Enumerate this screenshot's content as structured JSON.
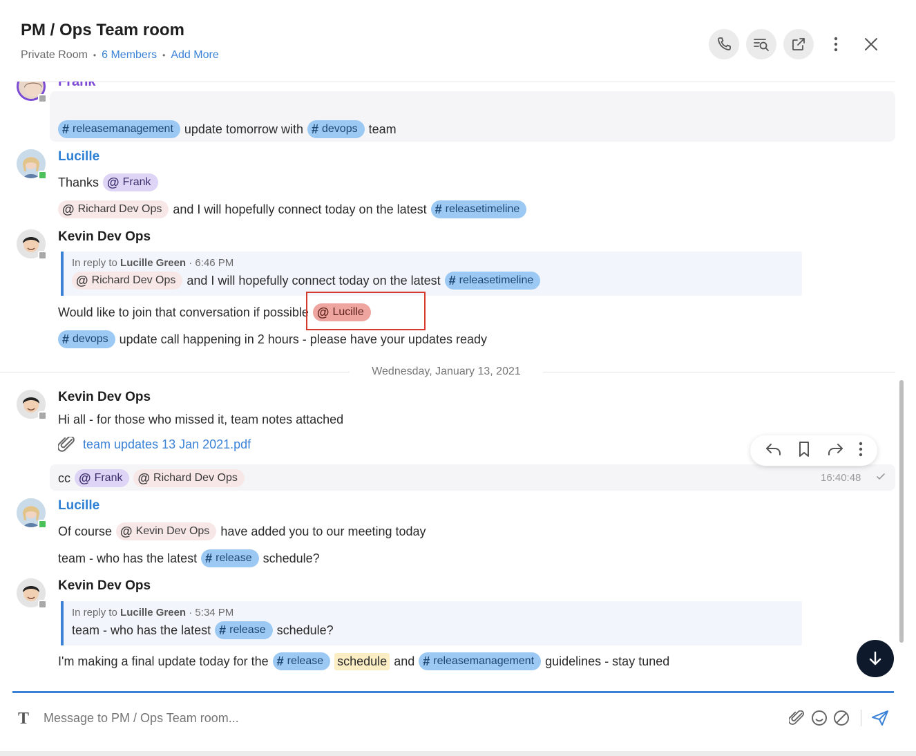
{
  "header": {
    "title": "PM / Ops Team room",
    "room_type": "Private Room",
    "members_link": "6 Members",
    "add_more_link": "Add More",
    "icons": [
      "phone-icon",
      "search-thread-icon",
      "external-link-icon",
      "more-vertical-icon",
      "close-icon"
    ]
  },
  "messages": {
    "m0": {
      "author": "Frank",
      "l1": {
        "tag1": "releasemanagement",
        "t1": "update tomorrow with",
        "tag2": "devops",
        "t2": "team"
      }
    },
    "m1": {
      "author": "Lucille",
      "l1": {
        "t1": "Thanks",
        "mention": "Frank"
      },
      "l2": {
        "mention": "Richard Dev Ops",
        "t1": "and I will hopefully connect today on the latest",
        "tag": "releasetimeline"
      }
    },
    "m2": {
      "author": "Kevin Dev Ops",
      "reply": {
        "prefix": "In reply to",
        "name": "Lucille Green",
        "time": "· 6:46 PM",
        "mention": "Richard Dev Ops",
        "t1": "and I will hopefully connect today on the latest",
        "tag": "releasetimeline"
      },
      "l1": {
        "t1": "Would like to join that conversation if possible",
        "mention": "Lucille"
      },
      "l2": {
        "tag": "devops",
        "t1": "update call happening in 2 hours - please have your updates ready"
      }
    },
    "date_separator": "Wednesday, January 13, 2021",
    "m3": {
      "author": "Kevin Dev Ops",
      "l1": "Hi all - for those who missed it, team notes attached",
      "file": "team updates 13 Jan 2021.pdf",
      "cc": {
        "prefix": "cc",
        "mention1": "Frank",
        "mention2": "Richard Dev Ops"
      },
      "timestamp": "16:40:48"
    },
    "m4": {
      "author": "Lucille",
      "l1": {
        "t1": "Of course",
        "mention": "Kevin Dev Ops",
        "t2": "have added you to our meeting today"
      },
      "l2": {
        "t1": "team - who has the latest",
        "tag": "release",
        "t2": "schedule?"
      }
    },
    "m5": {
      "author": "Kevin Dev Ops",
      "reply": {
        "prefix": "In reply to",
        "name": "Lucille Green",
        "time": "· 5:34 PM",
        "t1": "team - who has the latest",
        "tag": "release",
        "t2": "schedule?"
      },
      "l1": {
        "t1": "I'm making a final update today for the",
        "tag1": "release",
        "hl": "schedule",
        "t2": "and",
        "tag2": "releasemanagement",
        "t3": "guidelines - stay tuned"
      }
    }
  },
  "composer": {
    "placeholder": "Message to PM / Ops Team room...",
    "icons": [
      "text-format-icon",
      "attachment-icon",
      "emoji-icon",
      "gif-icon",
      "send-icon"
    ]
  },
  "colors": {
    "accent": "#3b82d6",
    "tag_chip": "#9bc9f4",
    "mention_self": "#eea59f",
    "mention_purple": "#ddd4f6",
    "highlight_box": "#d63a2f"
  }
}
